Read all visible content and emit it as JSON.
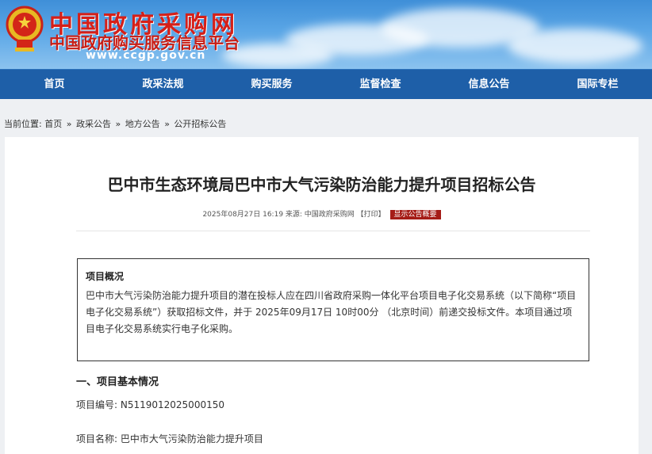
{
  "header": {
    "site_name": "中国政府采购网",
    "site_subtitle": "中国政府购买服务信息平台",
    "site_url": "www.ccgp.gov.cn"
  },
  "nav": {
    "items": [
      {
        "label": "首页"
      },
      {
        "label": "政采法规"
      },
      {
        "label": "购买服务"
      },
      {
        "label": "监督检查"
      },
      {
        "label": "信息公告"
      },
      {
        "label": "国际专栏"
      }
    ]
  },
  "breadcrumb": {
    "prefix": "当前位置:",
    "items": [
      "首页",
      "政采公告",
      "地方公告",
      "公开招标公告"
    ],
    "separator": "»"
  },
  "article": {
    "title": "巴中市生态环境局巴中市大气污染防治能力提升项目招标公告",
    "meta": "2025年08月27日 16:19 来源: 中国政府采购网 【打印】",
    "summary_button": "显示公告概要",
    "overview_title": "项目概况",
    "overview_body": "巴中市大气污染防治能力提升项目的潜在投标人应在四川省政府采购一体化平台项目电子化交易系统（以下简称“项目电子化交易系统”）获取招标文件，并于 2025年09月17日 10时00分 （北京时间）前递交投标文件。本项目通过项目电子化交易系统实行电子化采购。",
    "section_title": "一、项目基本情况",
    "project_number": "项目编号:  N5119012025000150",
    "project_name": "项目名称:  巴中市大气污染防治能力提升项目"
  },
  "colors": {
    "nav_bg": "#1e5fa8",
    "brand_red": "#d51f18",
    "summary_button_bg": "#a51c17"
  }
}
